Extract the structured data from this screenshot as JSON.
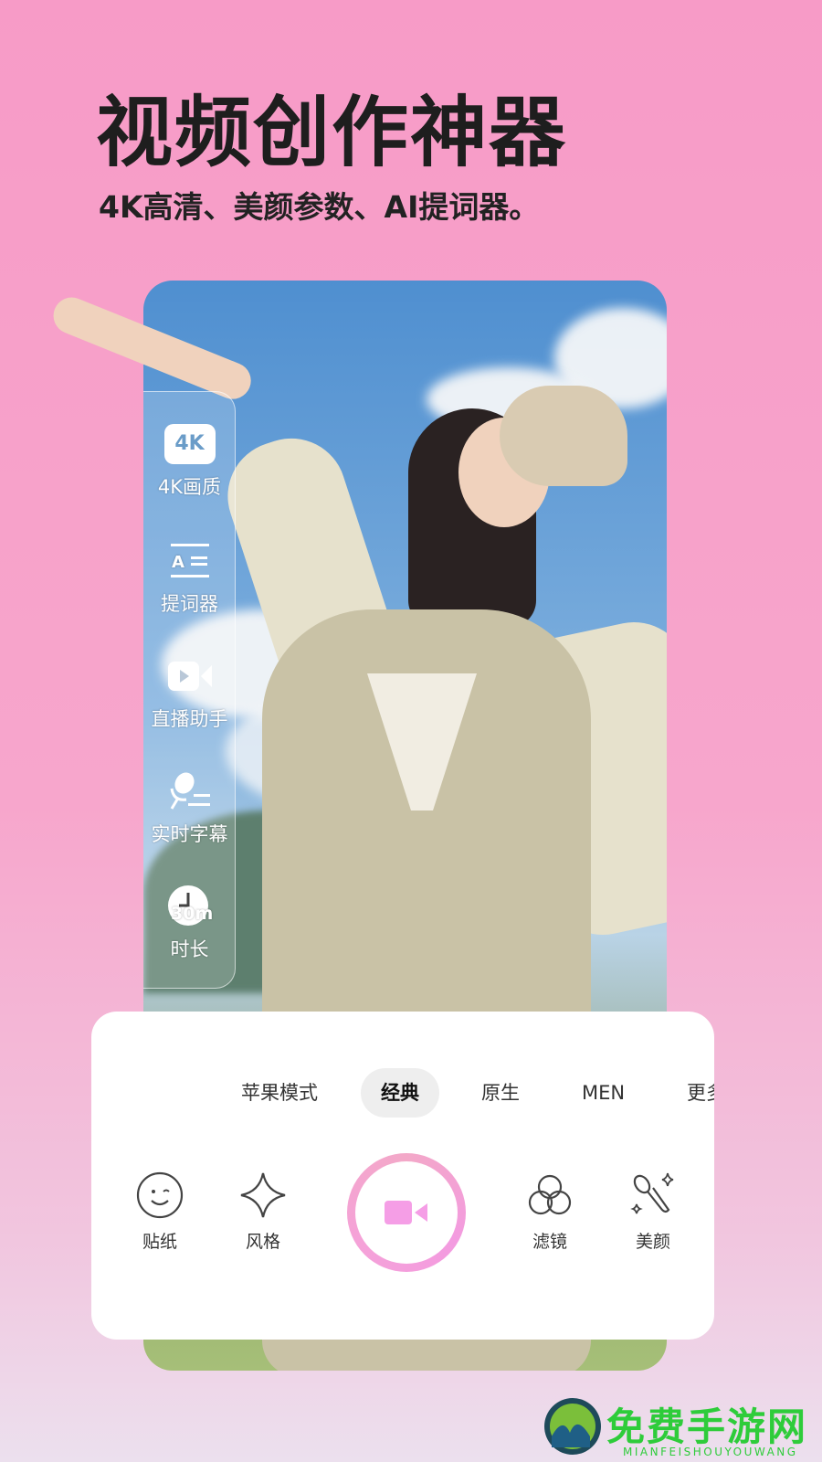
{
  "header": {
    "title": "视频创作神器",
    "subtitle": "4K高清、美颜参数、AI提词器。"
  },
  "sidebar": {
    "items": [
      {
        "label": "4K画质",
        "icon": "4k-icon",
        "badge": "4K"
      },
      {
        "label": "提词器",
        "icon": "teleprompter-icon"
      },
      {
        "label": "直播助手",
        "icon": "live-camera-icon"
      },
      {
        "label": "实时字幕",
        "icon": "subtitle-mic-icon"
      },
      {
        "label": "时长",
        "icon": "clock-icon",
        "badge": "30m"
      }
    ]
  },
  "panel": {
    "modes": [
      "苹果模式",
      "经典",
      "原生",
      "MEN",
      "更多"
    ],
    "active_mode": "经典",
    "tools": [
      {
        "label": "贴纸",
        "icon": "sticker-smile-icon"
      },
      {
        "label": "风格",
        "icon": "style-sparkle-icon"
      },
      {
        "label": "滤镜",
        "icon": "filter-circles-icon"
      },
      {
        "label": "美颜",
        "icon": "beauty-wand-icon"
      }
    ],
    "record_icon": "record-video-icon",
    "accent": "#f39be0"
  },
  "watermark": {
    "name": "免费手游网",
    "pinyin": "MIANFEISHOUYOUWANG",
    "color": "#2ecc3a"
  }
}
